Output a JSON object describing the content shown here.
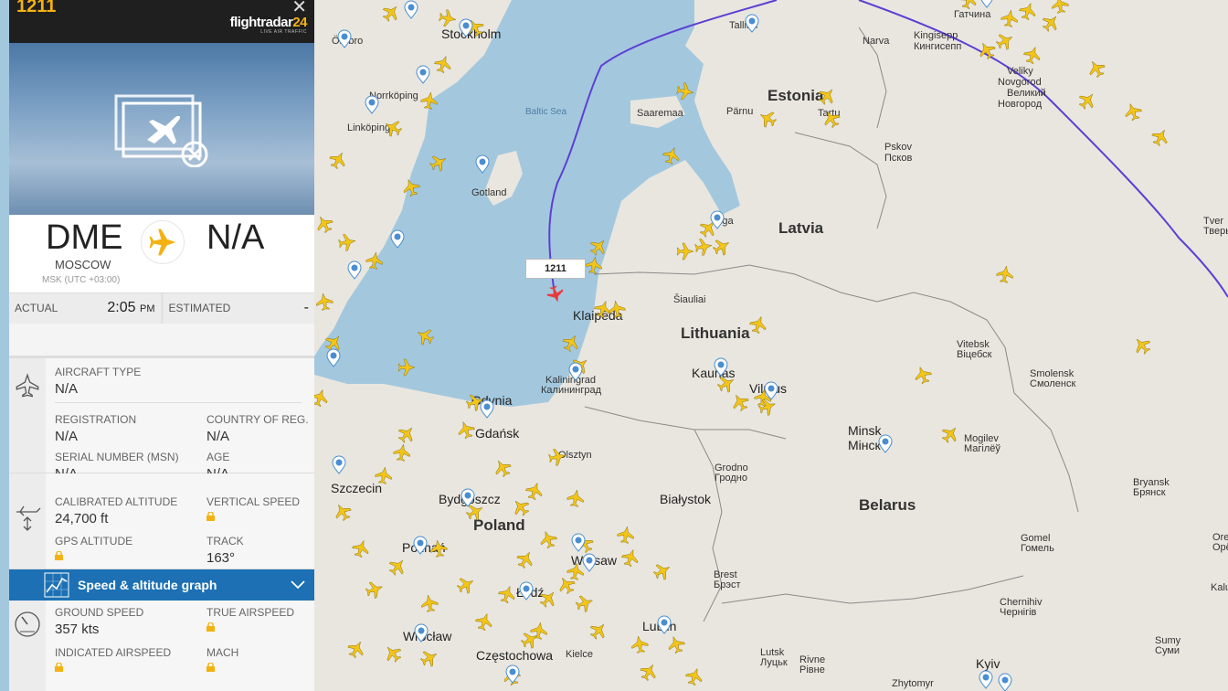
{
  "map": {
    "countries": [
      {
        "name": "Estonia"
      },
      {
        "name": "Latvia"
      },
      {
        "name": "Lithuania"
      },
      {
        "name": "Belarus"
      },
      {
        "name": "Poland"
      }
    ],
    "cities": [
      {
        "name": "Stockholm",
        "cls": "big"
      },
      {
        "name": "Tallinn",
        "cls": "city"
      },
      {
        "name": "Narva",
        "cls": "city"
      },
      {
        "name": "Kingisepp",
        "cls": "city"
      },
      {
        "name": "Кингисепп",
        "cls": "city"
      },
      {
        "name": "Veliky",
        "cls": "city"
      },
      {
        "name": "Novgorod",
        "cls": "city"
      },
      {
        "name": "Великий",
        "cls": "city"
      },
      {
        "name": "Новгород",
        "cls": "city"
      },
      {
        "name": "Norrköping",
        "cls": "city"
      },
      {
        "name": "Linköping",
        "cls": "city"
      },
      {
        "name": "Gotland",
        "cls": "city"
      },
      {
        "name": "Pärnu",
        "cls": "city"
      },
      {
        "name": "Tartu",
        "cls": "city"
      },
      {
        "name": "Saaremaa",
        "cls": "city"
      },
      {
        "name": "Pskov",
        "cls": "city"
      },
      {
        "name": "Псков",
        "cls": "city"
      },
      {
        "name": "Riga",
        "cls": "city"
      },
      {
        "name": "Šiauliai",
        "cls": "city"
      },
      {
        "name": "Klaipėda",
        "cls": "big"
      },
      {
        "name": "Kaunas",
        "cls": "big"
      },
      {
        "name": "Vilnius",
        "cls": "big"
      },
      {
        "name": "Kaliningrad",
        "cls": "city"
      },
      {
        "name": "Калининград",
        "cls": "city"
      },
      {
        "name": "Gdynia",
        "cls": "big"
      },
      {
        "name": "Gdańsk",
        "cls": "big"
      },
      {
        "name": "Olsztyn",
        "cls": "city"
      },
      {
        "name": "Grodno",
        "cls": "city"
      },
      {
        "name": "Гродно",
        "cls": "city"
      },
      {
        "name": "Białystok",
        "cls": "big"
      },
      {
        "name": "Szczecin",
        "cls": "big"
      },
      {
        "name": "Bydgoszcz",
        "cls": "big"
      },
      {
        "name": "Poznań",
        "cls": "big"
      },
      {
        "name": "Warsaw",
        "cls": "big"
      },
      {
        "name": "Łódź",
        "cls": "big"
      },
      {
        "name": "Lublin",
        "cls": "big"
      },
      {
        "name": "Wrocław",
        "cls": "big"
      },
      {
        "name": "Częstochowa",
        "cls": "big"
      },
      {
        "name": "Kielce",
        "cls": "city"
      },
      {
        "name": "Brest",
        "cls": "city"
      },
      {
        "name": "Брэст",
        "cls": "city"
      },
      {
        "name": "Lutsk",
        "cls": "city"
      },
      {
        "name": "Луцьк",
        "cls": "city"
      },
      {
        "name": "Rivne",
        "cls": "city"
      },
      {
        "name": "Рівне",
        "cls": "city"
      },
      {
        "name": "Zhytomyr",
        "cls": "city"
      },
      {
        "name": "Kyiv",
        "cls": "big"
      },
      {
        "name": "Minsk",
        "cls": "big"
      },
      {
        "name": "Мінск",
        "cls": "big"
      },
      {
        "name": "Vitebsk",
        "cls": "city"
      },
      {
        "name": "Віцебск",
        "cls": "city"
      },
      {
        "name": "Smolensk",
        "cls": "city"
      },
      {
        "name": "Смоленск",
        "cls": "city"
      },
      {
        "name": "Mogilev",
        "cls": "city"
      },
      {
        "name": "Магілёў",
        "cls": "city"
      },
      {
        "name": "Gomel",
        "cls": "city"
      },
      {
        "name": "Гомель",
        "cls": "city"
      },
      {
        "name": "Bryansk",
        "cls": "city"
      },
      {
        "name": "Брянск",
        "cls": "city"
      },
      {
        "name": "Chernihiv",
        "cls": "city"
      },
      {
        "name": "Чернігів",
        "cls": "city"
      },
      {
        "name": "Sumy",
        "cls": "city"
      },
      {
        "name": "Суми",
        "cls": "city"
      },
      {
        "name": "Tver",
        "cls": "city"
      },
      {
        "name": "Тверь",
        "cls": "city"
      },
      {
        "name": "Orel",
        "cls": "city"
      },
      {
        "name": "Орёл",
        "cls": "city"
      },
      {
        "name": "Kaluga",
        "cls": "city"
      },
      {
        "name": "Гатчина",
        "cls": "city"
      },
      {
        "name": "Örebro",
        "cls": "city"
      }
    ],
    "sea_label": "Baltic Sea",
    "selected_flight_label": "1211",
    "colors": {
      "land": "#e9e6df",
      "water": "#a3c8de",
      "track": "#5d3fd3",
      "plane": "#f3c519",
      "selected_plane": "#e8383d"
    }
  },
  "panel": {
    "callsign": "1211",
    "close_icon": "close-icon",
    "logo_text": "flightradar",
    "logo_num": "24",
    "logo_sub": "LIVE AIR TRAFFIC",
    "origin": {
      "code": "DME",
      "city": "MOSCOW",
      "tz": "MSK (UTC +03:00)"
    },
    "destination": {
      "code": "N/A"
    },
    "times": {
      "actual_label": "ACTUAL",
      "actual_value": "2:05",
      "actual_suffix": "PM",
      "estimated_label": "ESTIMATED",
      "estimated_value": "-"
    },
    "aircraft": {
      "type_label": "AIRCRAFT TYPE",
      "type_value": "N/A",
      "reg_label": "REGISTRATION",
      "reg_value": "N/A",
      "country_label": "COUNTRY OF REG.",
      "country_value": "N/A",
      "msn_label": "SERIAL NUMBER (MSN)",
      "msn_value": "N/A",
      "age_label": "AGE",
      "age_value": "N/A"
    },
    "altitude": {
      "cal_label": "CALIBRATED ALTITUDE",
      "cal_value": "24,700 ft",
      "vs_label": "VERTICAL SPEED",
      "gps_label": "GPS ALTITUDE",
      "track_label": "TRACK",
      "track_value": "163°"
    },
    "graph_bar": {
      "label": "Speed & altitude graph"
    },
    "speed": {
      "gs_label": "GROUND SPEED",
      "gs_value": "357 kts",
      "tas_label": "TRUE AIRSPEED",
      "ias_label": "INDICATED AIRSPEED",
      "mach_label": "MACH"
    }
  }
}
